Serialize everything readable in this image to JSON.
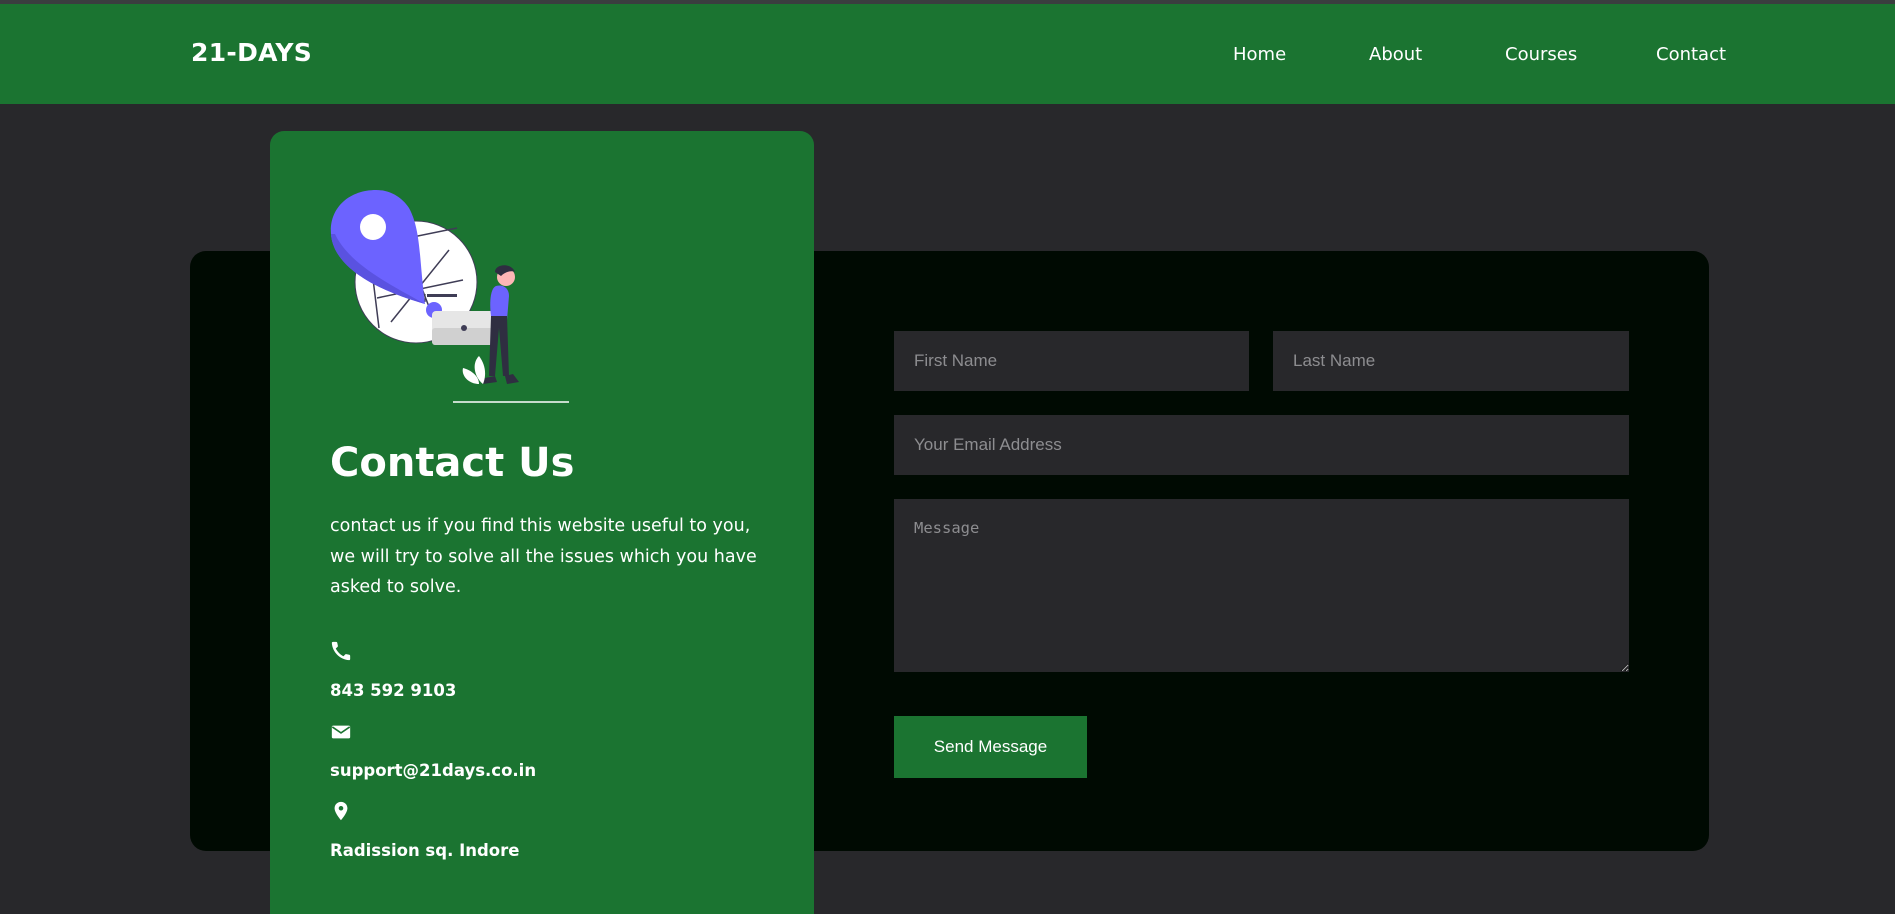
{
  "brand": {
    "name": "21-DAYS",
    "color": "#1b7431"
  },
  "nav": {
    "items": [
      "Home",
      "About",
      "Courses",
      "Contact"
    ]
  },
  "contact": {
    "title": "Contact Us",
    "description": "contact us if you find this website useful to you, we will try to solve all the issues which you have asked to solve.",
    "phone": "843 592 9103",
    "email": "support@21days.co.in",
    "address": "Radission sq. Indore",
    "icons": [
      "location-person-illustration",
      "phone-icon",
      "envelope-icon",
      "map-marker-icon"
    ]
  },
  "form": {
    "first_name_placeholder": "First Name",
    "last_name_placeholder": "Last Name",
    "email_placeholder": "Your Email Address",
    "message_placeholder": "Message",
    "submit_label": "Send Message"
  },
  "colors": {
    "accent": "#1b7431",
    "page_bg": "#28282b",
    "panel_bg": "#000a02",
    "illustration_accent": "#6c63ff"
  }
}
